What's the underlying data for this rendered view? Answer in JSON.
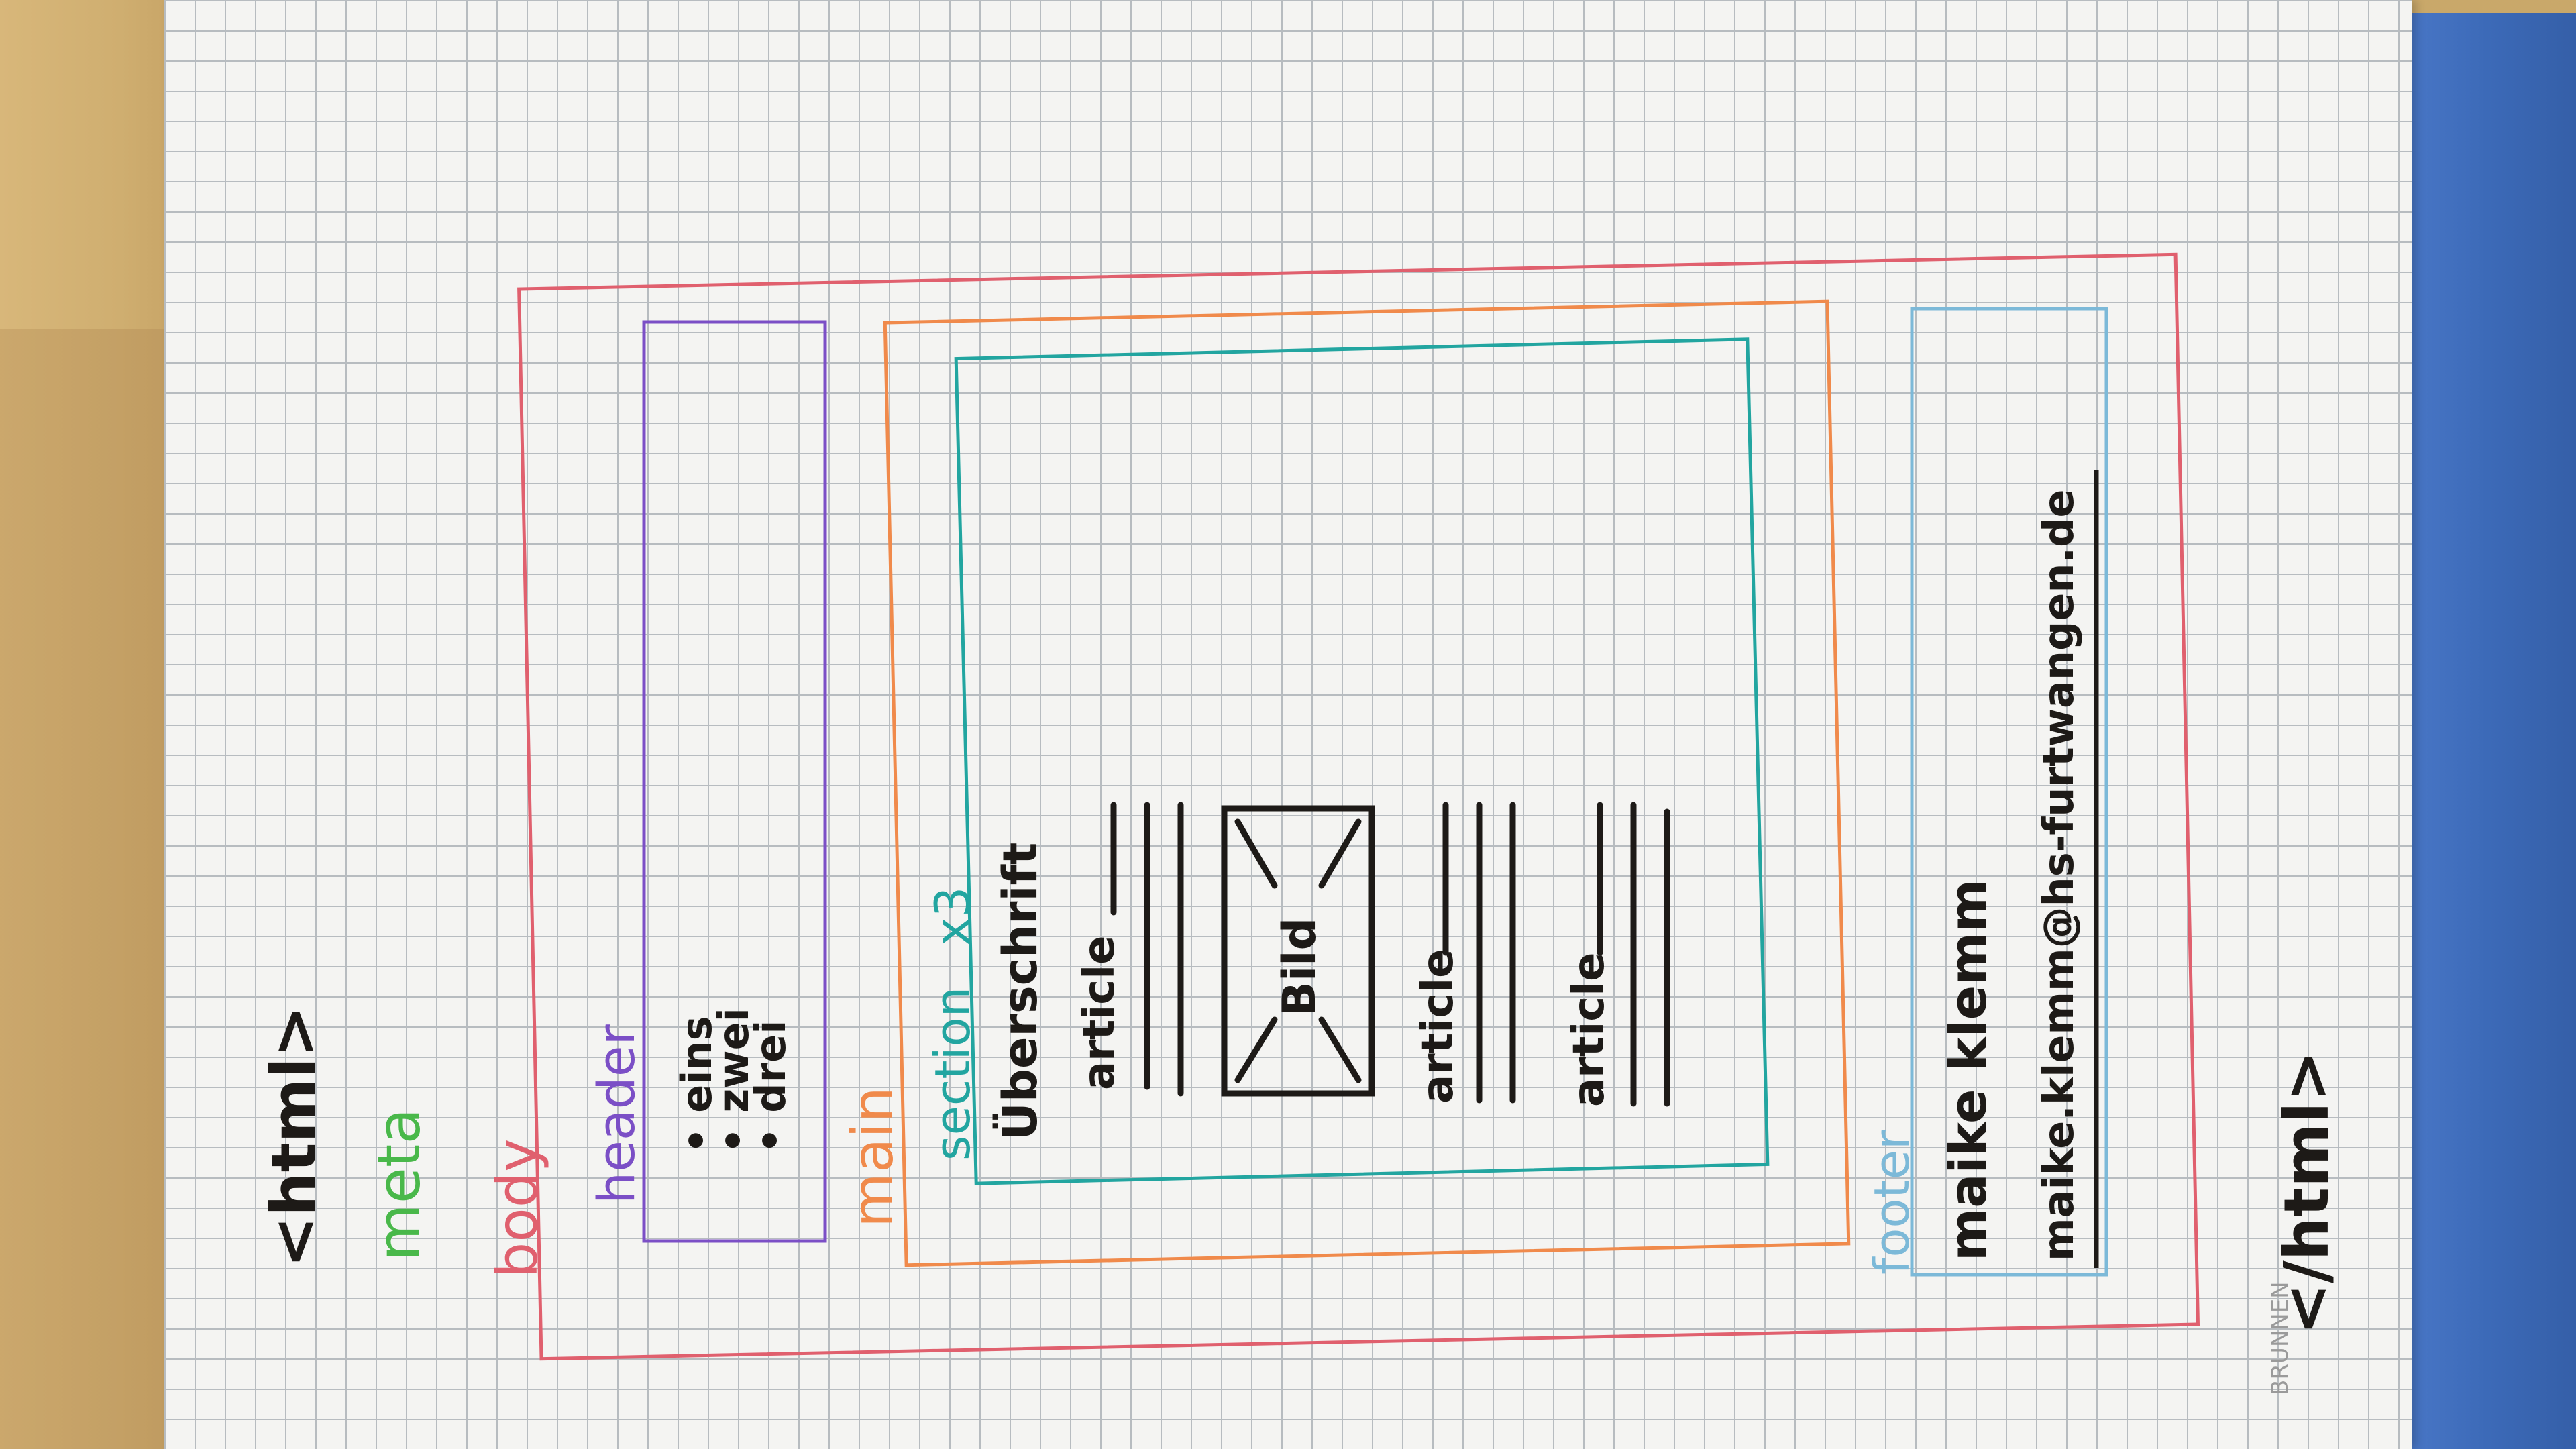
{
  "sketch": {
    "html_open": "<html>",
    "html_close": "</html>",
    "meta": "meta",
    "body": "body",
    "header": "header",
    "header_list": [
      "• eins",
      "• zwei",
      "• drei"
    ],
    "main": "main",
    "section": "section",
    "section_count": "x3",
    "heading": "Überschrift",
    "article_1": "article",
    "image": "Bild",
    "article_2": "article",
    "article_3": "article",
    "footer": "footer",
    "footer_name": "maike klemm",
    "footer_email": "maike.klemm@hs-furtwangen.de",
    "paper_brand": "BRUNNEN"
  },
  "colors": {
    "body": "#e0606e",
    "header": "#7b4fc6",
    "main": "#f08a4b",
    "section": "#22a5a0",
    "meta": "#49b84a",
    "footer": "#7cb9d8",
    "ink": "#1d1a17"
  }
}
